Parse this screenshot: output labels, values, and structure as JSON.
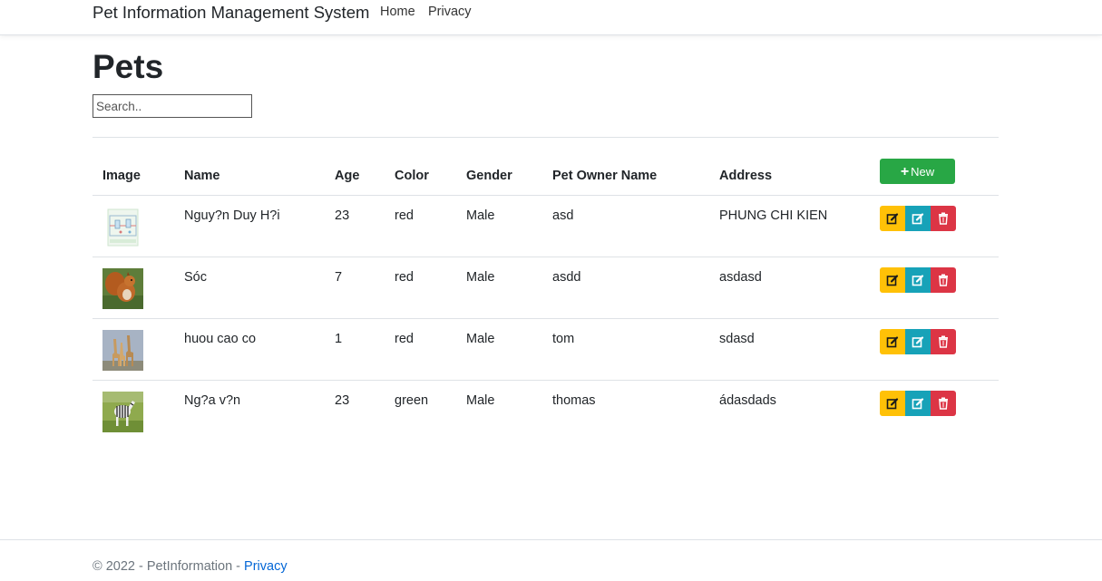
{
  "navbar": {
    "brand": "Pet Information Management System",
    "links": [
      "Home",
      "Privacy"
    ]
  },
  "page": {
    "title": "Pets",
    "search_placeholder": "Search.."
  },
  "table": {
    "headers": [
      "Image",
      "Name",
      "Age",
      "Color",
      "Gender",
      "Pet Owner Name",
      "Address"
    ],
    "new_button_label": "New",
    "rows": [
      {
        "image": "diagram-thumbnail",
        "name": "Nguy?n Duy H?i",
        "age": "23",
        "color": "red",
        "gender": "Male",
        "owner": "asd",
        "address": "PHUNG CHI KIEN"
      },
      {
        "image": "squirrel-photo",
        "name": "Sóc",
        "age": "7",
        "color": "red",
        "gender": "Male",
        "owner": "asdd",
        "address": "asdasd"
      },
      {
        "image": "giraffes-photo",
        "name": "huou cao co",
        "age": "1",
        "color": "red",
        "gender": "Male",
        "owner": "tom",
        "address": "sdasd"
      },
      {
        "image": "zebra-photo",
        "name": "Ng?a v?n",
        "age": "23",
        "color": "green",
        "gender": "Male",
        "owner": "thomas",
        "address": "ádasdads"
      }
    ],
    "action_icons": [
      "edit-icon",
      "edit-icon",
      "trash-icon"
    ]
  },
  "footer": {
    "text": "© 2022 - PetInformation - ",
    "link": "Privacy"
  },
  "colors": {
    "new_button": "#28a745",
    "edit_button_1": "#ffc107",
    "edit_button_2": "#17a2b8",
    "delete_button": "#dc3545",
    "link": "#0366d6"
  }
}
